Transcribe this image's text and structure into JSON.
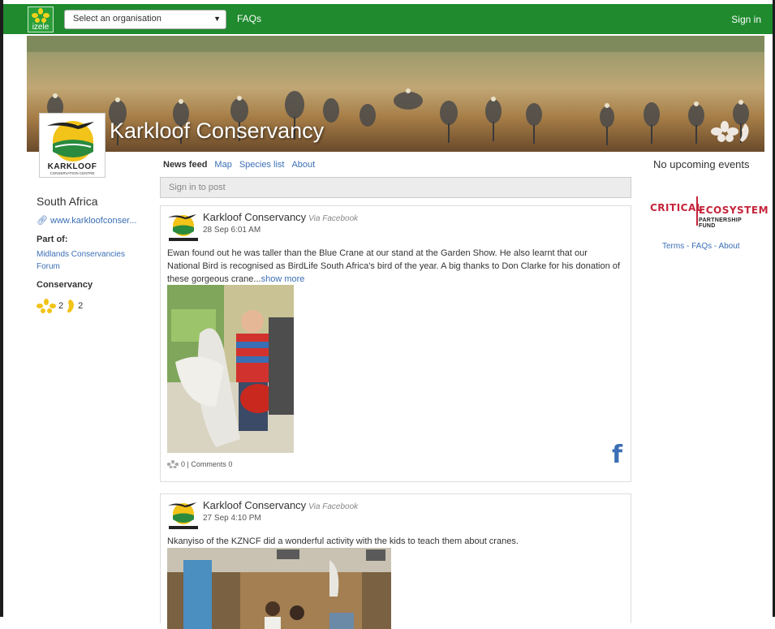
{
  "topbar": {
    "logo_text": "izele",
    "org_select_placeholder": "Select an organisation",
    "faqs_label": "FAQs",
    "signin_label": "Sign in",
    "accent": "#1f8a2e"
  },
  "banner": {
    "title": "Karkloof Conservancy"
  },
  "org_logo": {
    "name": "KARKLOOF",
    "tagline": "CONSERVATION CENTRE"
  },
  "left": {
    "country": "South Africa",
    "website": "www.karkloofconser...",
    "part_of_heading": "Part of:",
    "part_of_link": "Midlands Conservancies Forum",
    "type_heading": "Conservancy",
    "flower_count": "2",
    "foot_count": "2"
  },
  "tabs": [
    {
      "label": "News feed",
      "active": true
    },
    {
      "label": "Map"
    },
    {
      "label": "Species list"
    },
    {
      "label": "About"
    }
  ],
  "post_input_placeholder": "Sign in to post",
  "posts": [
    {
      "author": "Karkloof Conservancy",
      "via": "Via Facebook",
      "date": "28 Sep 6:01 AM",
      "text": "Ewan found out he was taller than the Blue Crane at our stand at the Garden Show. He also learnt that our National Bird is recognised as BirdLife South Africa's bird of the year. A big thanks to Don Clarke for his donation of these gorgeous crane...",
      "show_more": "show more",
      "stats": "0 | Comments 0",
      "fb_glyph": "f"
    },
    {
      "author": "Karkloof Conservancy",
      "via": "Via Facebook",
      "date": "27 Sep 4:10 PM",
      "text": "Nkanyiso of the KZNCF did a wonderful activity with the kids to teach them about cranes."
    }
  ],
  "right": {
    "events": "No upcoming events",
    "partner_word1": "CRITICAL",
    "partner_word2": "ECOSYSTEM",
    "partner_word3": "PARTNERSHIP FUND",
    "footer_links": "Terms - FAQs - About"
  }
}
